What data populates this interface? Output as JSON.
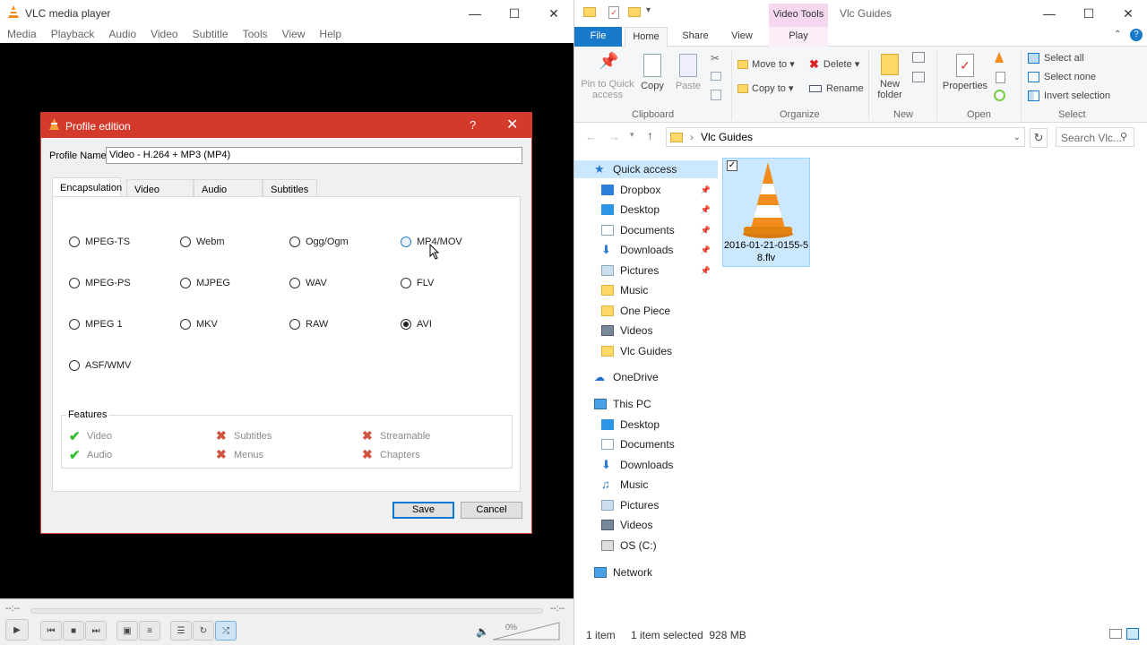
{
  "vlc": {
    "title": "VLC media player",
    "menu": [
      "Media",
      "Playback",
      "Audio",
      "Video",
      "Subtitle",
      "Tools",
      "View",
      "Help"
    ],
    "time_left": "--:--",
    "time_right": "--:--",
    "volume": "0%"
  },
  "dialog": {
    "title": "Profile edition",
    "help": "?",
    "profile_name_label": "Profile Name",
    "profile_name_value": "Video - H.264 + MP3 (MP4)",
    "tabs": [
      "Encapsulation",
      "Video codec",
      "Audio codec",
      "Subtitles"
    ],
    "formats": {
      "mpeg_ts": "MPEG-TS",
      "webm": "Webm",
      "ogg": "Ogg/Ogm",
      "mp4": "MP4/MOV",
      "mpeg_ps": "MPEG-PS",
      "mjpeg": "MJPEG",
      "wav": "WAV",
      "flv": "FLV",
      "mpeg1": "MPEG 1",
      "mkv": "MKV",
      "raw": "RAW",
      "avi": "AVI",
      "asf": "ASF/WMV"
    },
    "selected_format": "AVI",
    "features_label": "Features",
    "features": {
      "video": "Video",
      "audio": "Audio",
      "subtitles": "Subtitles",
      "menus": "Menus",
      "streamable": "Streamable",
      "chapters": "Chapters"
    },
    "save": "Save",
    "cancel": "Cancel"
  },
  "explorer": {
    "context_tab": "Video Tools",
    "title": "Vlc Guides",
    "tabs": {
      "file": "File",
      "home": "Home",
      "share": "Share",
      "view": "View",
      "play": "Play"
    },
    "ribbon": {
      "pin": "Pin to Quick access",
      "copy": "Copy",
      "paste": "Paste",
      "clipboard": "Clipboard",
      "move_to": "Move to",
      "copy_to": "Copy to",
      "delete": "Delete",
      "rename": "Rename",
      "organize": "Organize",
      "new_folder": "New folder",
      "new": "New",
      "properties": "Properties",
      "open": "Open",
      "select_all": "Select all",
      "select_none": "Select none",
      "invert_selection": "Invert selection",
      "select": "Select"
    },
    "address": "Vlc Guides",
    "search_placeholder": "Search Vlc...",
    "nav": {
      "quick_access": "Quick access",
      "dropbox": "Dropbox",
      "desktop": "Desktop",
      "documents": "Documents",
      "downloads": "Downloads",
      "pictures": "Pictures",
      "music": "Music",
      "one_piece": "One Piece",
      "videos": "Videos",
      "vlc_guides": "Vlc Guides",
      "onedrive": "OneDrive",
      "this_pc": "This PC",
      "pc_desktop": "Desktop",
      "pc_documents": "Documents",
      "pc_downloads": "Downloads",
      "pc_music": "Music",
      "pc_pictures": "Pictures",
      "pc_videos": "Videos",
      "os_c": "OS (C:)",
      "network": "Network"
    },
    "file": {
      "name": "2016-01-21-0155-58.flv"
    },
    "status": {
      "count": "1 item",
      "selected": "1 item selected  928 MB"
    }
  }
}
